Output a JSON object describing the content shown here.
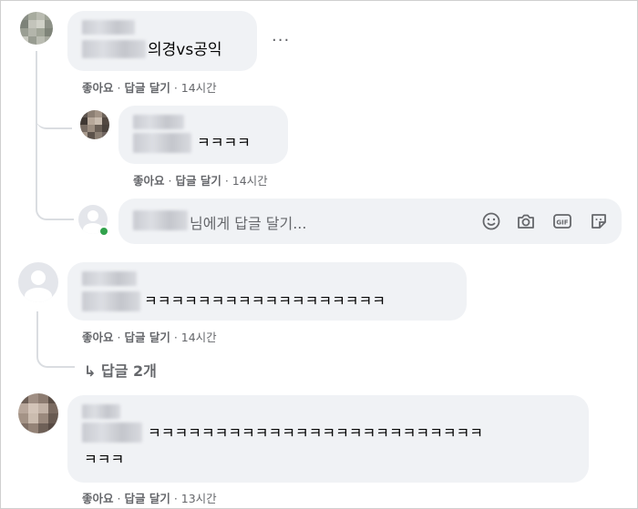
{
  "comments": [
    {
      "text": "의경vs공익",
      "like": "좋아요",
      "reply": "답글 달기",
      "time": "14시간"
    },
    {
      "text": "ㅋㅋㅋㅋ",
      "like": "좋아요",
      "reply": "답글 달기",
      "time": "14시간"
    },
    {
      "text": "ㅋㅋㅋㅋㅋㅋㅋㅋㅋㅋㅋㅋㅋㅋㅋㅋㅋㅋ",
      "like": "좋아요",
      "reply": "답글 달기",
      "time": "14시간"
    },
    {
      "text_line1": "ㅋㅋㅋㅋㅋㅋㅋㅋㅋㅋㅋㅋㅋㅋㅋㅋㅋㅋㅋㅋㅋㅋㅋㅋㅋ",
      "text_line2": "ㅋㅋㅋ",
      "like": "좋아요",
      "reply": "답글 달기",
      "time": "13시간"
    }
  ],
  "separator": "·",
  "more_label": "···",
  "reply_input": {
    "placeholder": "님에게 답글 달기..."
  },
  "view_replies": "↳ 답글 2개",
  "icons": [
    "smile-icon",
    "camera-icon",
    "gif-icon",
    "sticker-icon"
  ],
  "colors": {
    "bubble": "#f0f2f5",
    "meta": "#65676b",
    "online": "#31a24c"
  }
}
